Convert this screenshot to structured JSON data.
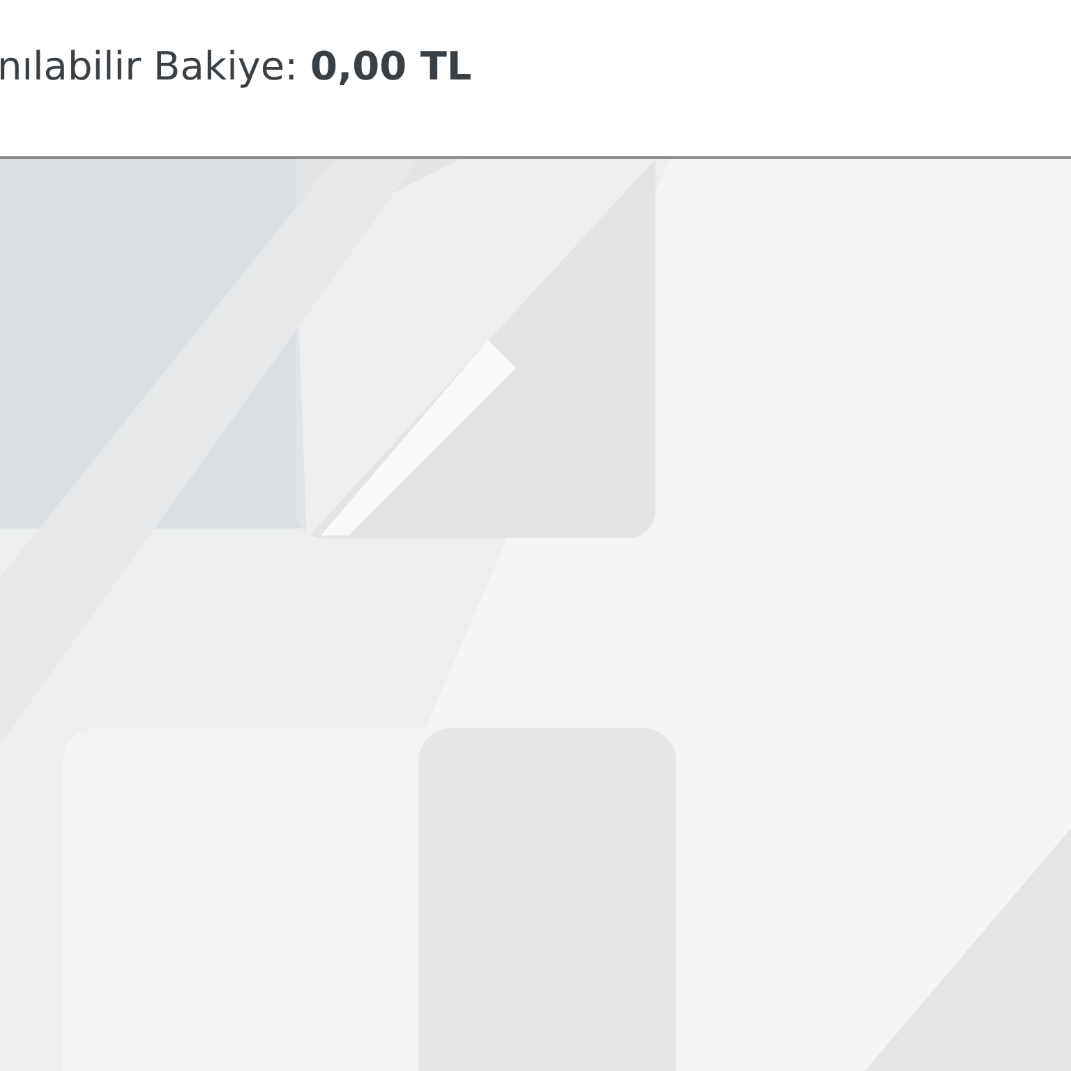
{
  "header": {
    "balance_text": "nılabilir Bakiye: **0,00 TL**"
  }
}
